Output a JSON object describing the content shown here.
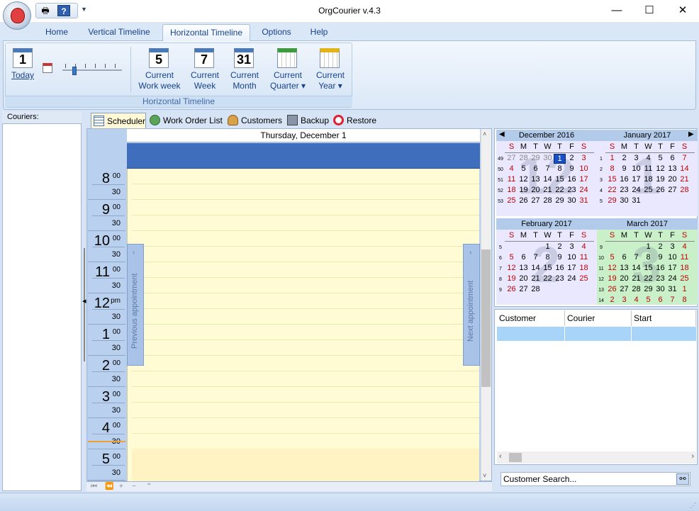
{
  "window": {
    "title": "OrgCourier v.4.3"
  },
  "ribbon_tabs": [
    "Home",
    "Vertical Timeline",
    "Horizontal Timeline",
    "Options",
    "Help"
  ],
  "ribbon": {
    "group_label": "Horizontal Timeline",
    "today_label": "Today",
    "today_icon_num": "1",
    "buttons": [
      {
        "line1": "Current",
        "line2": "Work week",
        "icon_num": "5"
      },
      {
        "line1": "Current",
        "line2": "Week",
        "icon_num": "7"
      },
      {
        "line1": "Current",
        "line2": "Month",
        "icon_num": "31"
      },
      {
        "line1": "Current",
        "line2": "Quarter ▾"
      },
      {
        "line1": "Current",
        "line2": "Year ▾"
      }
    ]
  },
  "couriers": {
    "header": "Couriers:"
  },
  "view_tabs": [
    "Scheduler",
    "Work Order List",
    "Customers",
    "Backup",
    "Restore"
  ],
  "scheduler": {
    "date_header": "Thursday, December 1",
    "prev_label": "Previous appointment",
    "next_label": "Next appointment",
    "hours": [
      {
        "h": "8",
        "s": "00"
      },
      {
        "h": "9",
        "s": "00"
      },
      {
        "h": "10",
        "s": "00"
      },
      {
        "h": "11",
        "s": "00"
      },
      {
        "h": "12",
        "s": "pm"
      },
      {
        "h": "1",
        "s": "00"
      },
      {
        "h": "2",
        "s": "00"
      },
      {
        "h": "3",
        "s": "00"
      },
      {
        "h": "4",
        "s": "00"
      },
      {
        "h": "5",
        "s": "00"
      }
    ],
    "half": "30"
  },
  "calendar": {
    "dow": [
      "S",
      "M",
      "T",
      "W",
      "T",
      "F",
      "S"
    ],
    "months": [
      {
        "title": "December 2016",
        "big": "12",
        "weeks": [
          "49",
          "50",
          "51",
          "52",
          "53"
        ],
        "days": [
          [
            "27",
            "28",
            "29",
            "30",
            "1",
            "2",
            "3"
          ],
          [
            "4",
            "5",
            "6",
            "7",
            "8",
            "9",
            "10"
          ],
          [
            "11",
            "12",
            "13",
            "14",
            "15",
            "16",
            "17"
          ],
          [
            "18",
            "19",
            "20",
            "21",
            "22",
            "23",
            "24"
          ],
          [
            "25",
            "26",
            "27",
            "28",
            "29",
            "30",
            "31"
          ]
        ]
      },
      {
        "title": "January 2017",
        "big": "1",
        "weeks": [
          "1",
          "2",
          "3",
          "4",
          "5"
        ],
        "days": [
          [
            "1",
            "2",
            "3",
            "4",
            "5",
            "6",
            "7"
          ],
          [
            "8",
            "9",
            "10",
            "11",
            "12",
            "13",
            "14"
          ],
          [
            "15",
            "16",
            "17",
            "18",
            "19",
            "20",
            "21"
          ],
          [
            "22",
            "23",
            "24",
            "25",
            "26",
            "27",
            "28"
          ],
          [
            "29",
            "30",
            "31",
            "",
            "",
            "",
            ""
          ]
        ]
      },
      {
        "title": "February 2017",
        "big": "2",
        "weeks": [
          "5",
          "6",
          "7",
          "8",
          "9"
        ],
        "days": [
          [
            "",
            "",
            "",
            "1",
            "2",
            "3",
            "4"
          ],
          [
            "5",
            "6",
            "7",
            "8",
            "9",
            "10",
            "11"
          ],
          [
            "12",
            "13",
            "14",
            "15",
            "16",
            "17",
            "18"
          ],
          [
            "19",
            "20",
            "21",
            "22",
            "23",
            "24",
            "25"
          ],
          [
            "26",
            "27",
            "28",
            "",
            "",
            "",
            ""
          ]
        ]
      },
      {
        "title": "March 2017",
        "big": "3",
        "weeks": [
          "9",
          "10",
          "11",
          "12",
          "13",
          "14"
        ],
        "days": [
          [
            "",
            "",
            "",
            "1",
            "2",
            "3",
            "4"
          ],
          [
            "5",
            "6",
            "7",
            "8",
            "9",
            "10",
            "11"
          ],
          [
            "12",
            "13",
            "14",
            "15",
            "16",
            "17",
            "18"
          ],
          [
            "19",
            "20",
            "21",
            "22",
            "23",
            "24",
            "25"
          ],
          [
            "26",
            "27",
            "28",
            "29",
            "30",
            "31",
            "1"
          ],
          [
            "2",
            "3",
            "4",
            "5",
            "6",
            "7",
            "8"
          ]
        ]
      }
    ]
  },
  "list": {
    "columns": [
      "Customer",
      "Courier",
      "Start"
    ]
  },
  "search": {
    "placeholder": "Customer Search..."
  }
}
